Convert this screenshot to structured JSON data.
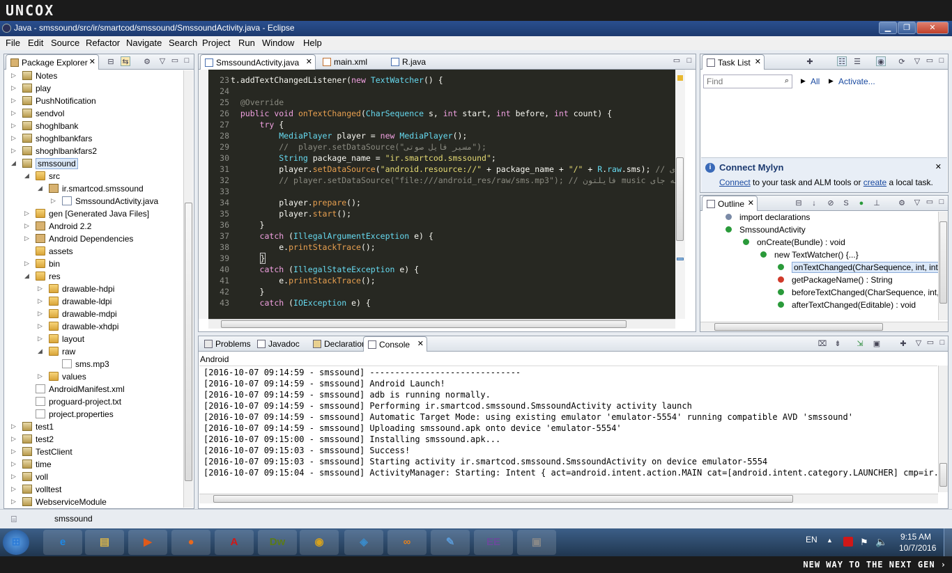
{
  "brand": {
    "logo": "uncox",
    "tagline": "NEW WAY TO THE NEXT GEN ›"
  },
  "window": {
    "title": "Java - smssound/src/ir/smartcod/smssound/SmssoundActivity.java - Eclipse",
    "min": "▁",
    "max": "❐",
    "close": "✕"
  },
  "menu": [
    "File",
    "Edit",
    "Source",
    "Refactor",
    "Navigate",
    "Search",
    "Project",
    "Run",
    "Window",
    "Help"
  ],
  "explorer": {
    "title": "Package Explorer",
    "rows": [
      {
        "label": "Notes",
        "depth": 0,
        "kind": "proj",
        "tw": "▷"
      },
      {
        "label": "play",
        "depth": 0,
        "kind": "proj",
        "tw": "▷"
      },
      {
        "label": "PushNotification",
        "depth": 0,
        "kind": "proj",
        "tw": "▷"
      },
      {
        "label": "sendvol",
        "depth": 0,
        "kind": "proj",
        "tw": "▷"
      },
      {
        "label": "shoghlbank",
        "depth": 0,
        "kind": "proj",
        "tw": "▷"
      },
      {
        "label": "shoghlbankfars",
        "depth": 0,
        "kind": "proj",
        "tw": "▷"
      },
      {
        "label": "shoghlbankfars2",
        "depth": 0,
        "kind": "proj",
        "tw": "▷"
      },
      {
        "label": "smssound",
        "depth": 0,
        "kind": "proj",
        "tw": "◢",
        "selected": true
      },
      {
        "label": "src",
        "depth": 1,
        "kind": "folder",
        "tw": "◢"
      },
      {
        "label": "ir.smartcod.smssound",
        "depth": 2,
        "kind": "pkg",
        "tw": "◢"
      },
      {
        "label": "SmssoundActivity.java",
        "depth": 3,
        "kind": "jfile",
        "tw": "▷"
      },
      {
        "label": "gen [Generated Java Files]",
        "depth": 1,
        "kind": "folder",
        "tw": "▷"
      },
      {
        "label": "Android 2.2",
        "depth": 1,
        "kind": "lib",
        "tw": "▷"
      },
      {
        "label": "Android Dependencies",
        "depth": 1,
        "kind": "lib",
        "tw": "▷"
      },
      {
        "label": "assets",
        "depth": 1,
        "kind": "folder",
        "tw": ""
      },
      {
        "label": "bin",
        "depth": 1,
        "kind": "folder",
        "tw": "▷"
      },
      {
        "label": "res",
        "depth": 1,
        "kind": "folder",
        "tw": "◢"
      },
      {
        "label": "drawable-hdpi",
        "depth": 2,
        "kind": "folder",
        "tw": "▷"
      },
      {
        "label": "drawable-ldpi",
        "depth": 2,
        "kind": "folder",
        "tw": "▷"
      },
      {
        "label": "drawable-mdpi",
        "depth": 2,
        "kind": "folder",
        "tw": "▷"
      },
      {
        "label": "drawable-xhdpi",
        "depth": 2,
        "kind": "folder",
        "tw": "▷"
      },
      {
        "label": "layout",
        "depth": 2,
        "kind": "folder",
        "tw": "▷"
      },
      {
        "label": "raw",
        "depth": 2,
        "kind": "folder",
        "tw": "◢"
      },
      {
        "label": "sms.mp3",
        "depth": 3,
        "kind": "xfile",
        "tw": ""
      },
      {
        "label": "values",
        "depth": 2,
        "kind": "folder",
        "tw": "▷"
      },
      {
        "label": "AndroidManifest.xml",
        "depth": 1,
        "kind": "xfile",
        "tw": ""
      },
      {
        "label": "proguard-project.txt",
        "depth": 1,
        "kind": "xfile",
        "tw": ""
      },
      {
        "label": "project.properties",
        "depth": 1,
        "kind": "xfile",
        "tw": ""
      },
      {
        "label": "test1",
        "depth": 0,
        "kind": "proj",
        "tw": "▷"
      },
      {
        "label": "test2",
        "depth": 0,
        "kind": "proj",
        "tw": "▷"
      },
      {
        "label": "TestClient",
        "depth": 0,
        "kind": "proj",
        "tw": "▷"
      },
      {
        "label": "time",
        "depth": 0,
        "kind": "proj",
        "tw": "▷"
      },
      {
        "label": "voll",
        "depth": 0,
        "kind": "proj",
        "tw": "▷"
      },
      {
        "label": "volltest",
        "depth": 0,
        "kind": "proj",
        "tw": "▷"
      },
      {
        "label": "WebserviceModule",
        "depth": 0,
        "kind": "proj",
        "tw": "▷"
      }
    ]
  },
  "editor": {
    "tabs": [
      "SmssoundActivity.java",
      "main.xml",
      "R.java"
    ],
    "lines": [
      {
        "n": "",
        "html": "<span class='cm'>                                                  </span>"
      },
      {
        "n": "23",
        "html": "t.addTextChangedListener(<span class='kw'>new</span> <span class='ty'>TextWatcher</span>() {"
      },
      {
        "n": "24",
        "html": ""
      },
      {
        "n": "25",
        "html": "  <span class='cm'>@Override</span>"
      },
      {
        "n": "26",
        "html": "  <span class='kw'>public void</span> <span class='mt'>onTextChanged</span>(<span class='ty'>CharSequence</span> s, <span class='kw'>int</span> start, <span class='kw'>int</span> before, <span class='kw'>int</span> count) {"
      },
      {
        "n": "27",
        "html": "      <span class='kw'>try</span> {"
      },
      {
        "n": "28",
        "html": "          <span class='ty'>MediaPlayer</span> player = <span class='kw'>new</span> <span class='ty'>MediaPlayer</span>();"
      },
      {
        "n": "29",
        "html": "          <span class='cm'>//  player.setDataSource(\"مسیر فایل صوتی\");</span>"
      },
      {
        "n": "30",
        "html": "          <span class='ty'>String</span> package_name = <span class='st'>\"ir.smartcod.smssound\"</span>;"
      },
      {
        "n": "31",
        "html": "          player.<span class='mt'>setDataSource</span>(<span class='st'>\"android.resource://\"</span> + package_name + <span class='st'>\"/\"</span> + <span class='ty'>R</span>.<span class='ty'>raw</span>.sms); <span class='cm'>// جای</span>"
      },
      {
        "n": "32",
        "html": "          <span class='cm'>// player.setDataSource(\"file:///android_res/raw/sms.mp3\"); // فایلتون music به جای</span>"
      },
      {
        "n": "33",
        "html": ""
      },
      {
        "n": "34",
        "html": "          player.<span class='mt'>prepare</span>();"
      },
      {
        "n": "35",
        "html": "          player.<span class='mt'>start</span>();"
      },
      {
        "n": "36",
        "html": "      }"
      },
      {
        "n": "37",
        "html": "      <span class='kw'>catch</span> (<span class='ty'>IllegalArgumentException</span> e) {"
      },
      {
        "n": "38",
        "html": "          e.<span class='mt'>printStackTrace</span>();"
      },
      {
        "n": "39",
        "html": "      <span style='border:1px solid #ccc'>}</span>"
      },
      {
        "n": "40",
        "html": "      <span class='kw'>catch</span> (<span class='ty'>IllegalStateException</span> e) {"
      },
      {
        "n": "41",
        "html": "          e.<span class='mt'>printStackTrace</span>();"
      },
      {
        "n": "42",
        "html": "      }"
      },
      {
        "n": "43",
        "html": "      <span class='kw'>catch</span> (<span class='ty'>IOException</span> e) {"
      }
    ]
  },
  "tasklist": {
    "title": "Task List",
    "find_placeholder": "Find",
    "all": "All",
    "activate": "Activate...",
    "mylyn_title": "Connect Mylyn",
    "mylyn_connect": "Connect",
    "mylyn_text1": " to your task and ALM tools or ",
    "mylyn_create": "create",
    "mylyn_text2": " a local task."
  },
  "outline": {
    "title": "Outline",
    "rows": [
      {
        "label": "import declarations",
        "indent": 1
      },
      {
        "label": "SmssoundActivity",
        "indent": 1
      },
      {
        "label": "onCreate(Bundle) : void",
        "indent": 2
      },
      {
        "label": "new TextWatcher() {...}",
        "indent": 3
      },
      {
        "label": "onTextChanged(CharSequence, int, int,",
        "indent": 4,
        "selected": true
      },
      {
        "label": "getPackageName() : String",
        "indent": 4
      },
      {
        "label": "beforeTextChanged(CharSequence, int,",
        "indent": 4
      },
      {
        "label": "afterTextChanged(Editable) : void",
        "indent": 4
      }
    ]
  },
  "bottom": {
    "tabs": [
      "Problems",
      "Javadoc",
      "Declaration",
      "Console"
    ],
    "console_label": "Android",
    "lines": [
      "[2016-10-07 09:14:59 - smssound] ------------------------------",
      "[2016-10-07 09:14:59 - smssound] Android Launch!",
      "[2016-10-07 09:14:59 - smssound] adb is running normally.",
      "[2016-10-07 09:14:59 - smssound] Performing ir.smartcod.smssound.SmssoundActivity activity launch",
      "[2016-10-07 09:14:59 - smssound] Automatic Target Mode: using existing emulator 'emulator-5554' running compatible AVD 'smssound'",
      "[2016-10-07 09:14:59 - smssound] Uploading smssound.apk onto device 'emulator-5554'",
      "[2016-10-07 09:15:00 - smssound] Installing smssound.apk...",
      "[2016-10-07 09:15:03 - smssound] Success!",
      "[2016-10-07 09:15:03 - smssound] Starting activity ir.smartcod.smssound.SmssoundActivity on device emulator-5554",
      "[2016-10-07 09:15:04 - smssound] ActivityManager: Starting: Intent { act=android.intent.action.MAIN cat=[android.intent.category.LAUNCHER] cmp=ir.smar"
    ]
  },
  "status": {
    "text": "smssound"
  },
  "taskbar": {
    "apps": [
      {
        "name": "start-orb",
        "glyph": "⊞",
        "color": "#2d7bd6"
      },
      {
        "name": "internet-explorer-icon",
        "glyph": "e",
        "color": "#1e88e5"
      },
      {
        "name": "file-explorer-icon",
        "glyph": "▤",
        "color": "#d9b44a"
      },
      {
        "name": "media-player-icon",
        "glyph": "▶",
        "color": "#e05a1a"
      },
      {
        "name": "firefox-icon",
        "glyph": "●",
        "color": "#e8691e"
      },
      {
        "name": "avira-icon",
        "glyph": "A",
        "color": "#d01818"
      },
      {
        "name": "dreamweaver-icon",
        "glyph": "Dw",
        "color": "#5a7a1a"
      },
      {
        "name": "chrome-icon",
        "glyph": "◉",
        "color": "#d6a21e"
      },
      {
        "name": "security-icon",
        "glyph": "◈",
        "color": "#3a8ac8"
      },
      {
        "name": "sync-icon",
        "glyph": "∞",
        "color": "#e0801e"
      },
      {
        "name": "paint-icon",
        "glyph": "✎",
        "color": "#5a9ad8"
      },
      {
        "name": "eclipse-javaee-icon",
        "glyph": "EE",
        "color": "#6a4a9a"
      },
      {
        "name": "window-icon",
        "glyph": "▣",
        "color": "#888888"
      }
    ],
    "lang": "EN",
    "time": "9:15 AM",
    "date": "10/7/2016"
  }
}
